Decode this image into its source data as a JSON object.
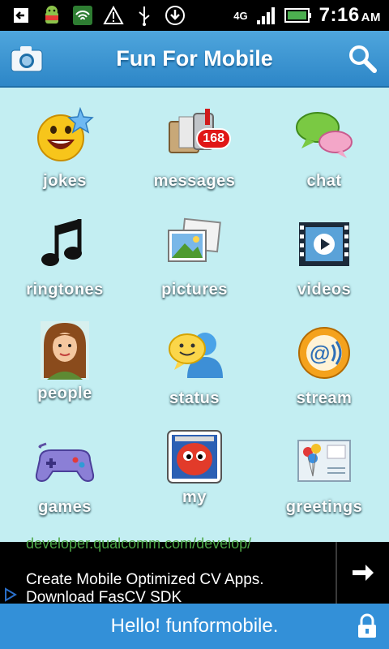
{
  "status_bar": {
    "time": "7:16",
    "ampm": "AM",
    "network": "4G",
    "icons": [
      "back-icon",
      "android-icon",
      "shield-icon",
      "warning-icon",
      "usb-icon",
      "download-icon",
      "signal-icon",
      "battery-icon"
    ]
  },
  "header": {
    "title": "Fun For Mobile",
    "camera_icon": "camera-icon",
    "search_icon": "search-icon"
  },
  "tiles": [
    {
      "label": "jokes",
      "icon": "jokes-icon"
    },
    {
      "label": "messages",
      "icon": "messages-icon",
      "badge": "168"
    },
    {
      "label": "chat",
      "icon": "chat-icon"
    },
    {
      "label": "ringtones",
      "icon": "ringtones-icon"
    },
    {
      "label": "pictures",
      "icon": "pictures-icon"
    },
    {
      "label": "videos",
      "icon": "videos-icon"
    },
    {
      "label": "people",
      "icon": "people-icon"
    },
    {
      "label": "status",
      "icon": "status-icon"
    },
    {
      "label": "stream",
      "icon": "stream-icon"
    },
    {
      "label": "games",
      "icon": "games-icon"
    },
    {
      "label": "my",
      "icon": "my-icon"
    },
    {
      "label": "greetings",
      "icon": "greetings-icon"
    }
  ],
  "ad": {
    "url_text": "developer.qualcomm.com/develop/",
    "line1": "Create Mobile Optimized CV Apps.",
    "line2": "Download FasCV SDK"
  },
  "footer": {
    "text": "Hello! funformobile."
  },
  "colors": {
    "background": "#c3eef2",
    "header": "#3390d8",
    "badge": "#e01717"
  }
}
